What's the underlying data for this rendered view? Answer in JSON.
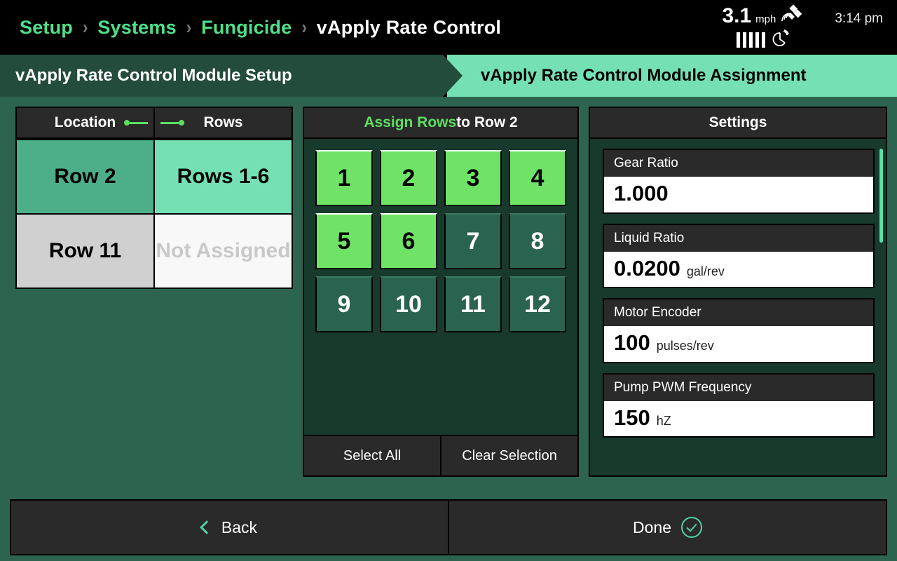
{
  "statusbar": {
    "breadcrumb": [
      {
        "label": "Setup",
        "active": false
      },
      {
        "label": "Systems",
        "active": false
      },
      {
        "label": "Fungicide",
        "active": false
      },
      {
        "label": "vApply Rate Control",
        "active": true
      }
    ],
    "separator": "›",
    "speed_value": "3.1",
    "speed_unit": "mph",
    "satellite_icon": "satellite-icon",
    "signal_icon": "signal-bars-icon",
    "dish_icon": "satellite-dish-icon",
    "signal_bars": 5,
    "clock": "3:14 pm"
  },
  "stages": {
    "previous": "vApply Rate Control Module Setup",
    "current": "vApply Rate Control Module Assignment"
  },
  "location_table": {
    "header_location": "Location",
    "header_rows": "Rows",
    "link_icon": "link-icon",
    "rows": [
      {
        "location": "Row 2",
        "assignment": "Rows 1-6",
        "selected": true
      },
      {
        "location": "Row 11",
        "assignment": "Not Assigned",
        "selected": false
      }
    ]
  },
  "assign_panel": {
    "title_highlight": "Assign Rows",
    "title_rest": " to Row 2",
    "buttons": [
      {
        "label": "1",
        "selected": true
      },
      {
        "label": "2",
        "selected": true
      },
      {
        "label": "3",
        "selected": true
      },
      {
        "label": "4",
        "selected": true
      },
      {
        "label": "5",
        "selected": true
      },
      {
        "label": "6",
        "selected": true
      },
      {
        "label": "7",
        "selected": false
      },
      {
        "label": "8",
        "selected": false
      },
      {
        "label": "9",
        "selected": false
      },
      {
        "label": "10",
        "selected": false
      },
      {
        "label": "11",
        "selected": false
      },
      {
        "label": "12",
        "selected": false
      }
    ],
    "select_all": "Select All",
    "clear_selection": "Clear Selection"
  },
  "settings": {
    "title": "Settings",
    "items": [
      {
        "label": "Gear Ratio",
        "value": "1.000",
        "unit": ""
      },
      {
        "label": "Liquid Ratio",
        "value": "0.0200",
        "unit": "gal/rev"
      },
      {
        "label": "Motor Encoder",
        "value": "100",
        "unit": "pulses/rev"
      },
      {
        "label": "Pump PWM Frequency",
        "value": "150",
        "unit": "hZ"
      }
    ]
  },
  "footer": {
    "back": "Back",
    "done": "Done",
    "back_icon": "chevron-left-icon",
    "done_icon": "check-circle-icon"
  },
  "colors": {
    "page_bg": "#2d6450",
    "panel_bg": "#183a2c",
    "header_bg": "#2a2a2a",
    "accent_green": "#5ce062",
    "mint": "#74e0b4",
    "selected_btn": "#6ee365",
    "unselected_btn": "#2a6350",
    "teal_icon": "#4fd1a5"
  }
}
